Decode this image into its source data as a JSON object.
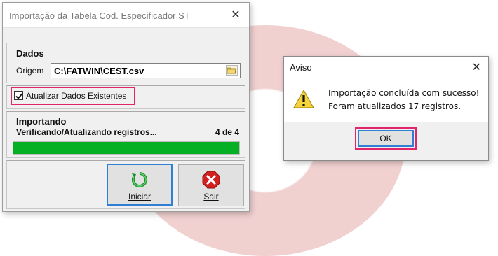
{
  "main_dialog": {
    "title": "Importação da Tabela Cod. Especificador ST",
    "close_glyph": "✕",
    "dados": {
      "title": "Dados",
      "origem_label": "Origem",
      "origem_value": "C:\\FATWIN\\CEST.csv"
    },
    "checkbox": {
      "label": "Atualizar Dados Existentes",
      "checked": true
    },
    "progress": {
      "title": "Importando",
      "status": "Verificando/Atualizando registros...",
      "counter": "4 de 4",
      "fraction": 1.0
    },
    "buttons": {
      "iniciar": "Iniciar",
      "sair": "Sair"
    }
  },
  "aviso_dialog": {
    "title": "Aviso",
    "close_glyph": "✕",
    "message_line1": "Importação concluída com sucesso!",
    "message_line2": "Foram atualizados 17 registros.",
    "ok_label": "OK"
  },
  "colors": {
    "highlight": "#e0256a",
    "progress": "#06b025",
    "focus": "#2f7fd4"
  },
  "icons": [
    "folder-icon",
    "refresh-icon",
    "exit-icon",
    "warning-icon",
    "checkmark-icon"
  ]
}
